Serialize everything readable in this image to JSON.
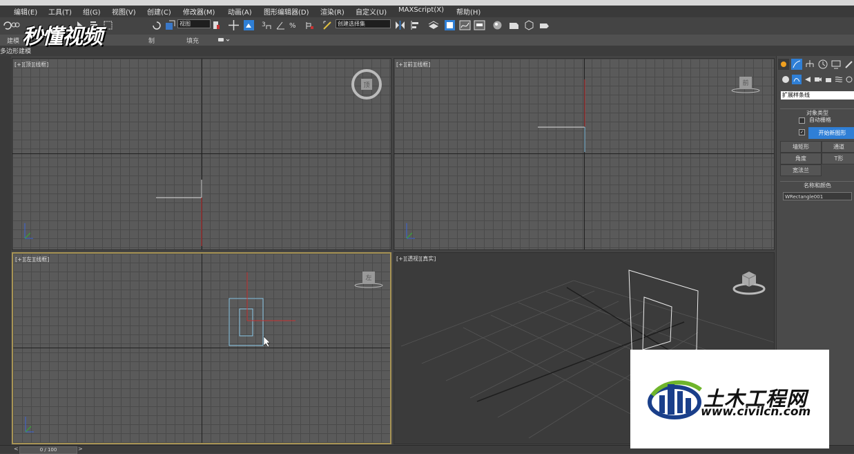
{
  "menu": [
    "编辑(E)",
    "工具(T)",
    "组(G)",
    "视图(V)",
    "创建(C)",
    "修改器(M)",
    "动画(A)",
    "图形编辑器(D)",
    "渲染(R)",
    "自定义(U)",
    "MAXScript(X)",
    "帮助(H)"
  ],
  "toolbar": {
    "view_dropdown": "视图",
    "selection_set_dropdown": "创建选择集"
  },
  "ribbon": {
    "tabs": [
      "建模",
      "制",
      "填充"
    ],
    "sub": "多边形建模"
  },
  "viewports": [
    {
      "label": "[+][顶][线框]",
      "cube": "顶"
    },
    {
      "label": "[+][前][线框]",
      "cube": "前"
    },
    {
      "label": "[+][左][线框]",
      "cube": "左"
    },
    {
      "label": "[+][透视][真实]",
      "cube": ""
    }
  ],
  "command_panel": {
    "category": "扩展样条线",
    "object_type_title": "对象类型",
    "autogrid": "自动栅格",
    "start_new_shape": "开始新图形",
    "buttons": [
      "墙矩形",
      "通道",
      "角度",
      "T形",
      "宽法兰"
    ],
    "name_color_title": "名称和颜色",
    "object_name": "WRectangle001"
  },
  "timeline": {
    "frame": "0 / 100"
  },
  "watermarks": {
    "top_logo": "秒懂视频",
    "site_name": "土木工程网",
    "site_url": "www.civilcn.com"
  },
  "colors": {
    "active_border": "#a89455",
    "accent_blue": "#2f7fd6",
    "axis_red": "#c83232",
    "axis_green": "#32b432",
    "axis_blue": "#3a64d8"
  }
}
